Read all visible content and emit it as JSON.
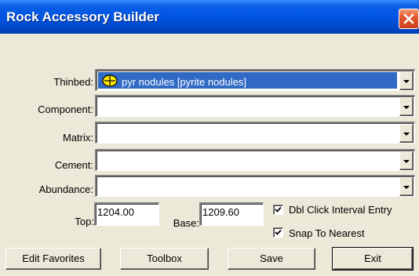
{
  "window": {
    "title": "Rock Accessory Builder"
  },
  "fields": {
    "thinbed": {
      "label": "Thinbed:",
      "value": "pyr nodules [pyrite nodules]",
      "icon": "pyrite-nodule-icon"
    },
    "component": {
      "label": "Component:",
      "value": ""
    },
    "matrix": {
      "label": "Matrix:",
      "value": ""
    },
    "cement": {
      "label": "Cement:",
      "value": ""
    },
    "abundance": {
      "label": "Abundance:",
      "value": ""
    }
  },
  "interval": {
    "top_label": "Top:",
    "top_value": "1204.00",
    "base_label": "Base:",
    "base_value": "1209.60"
  },
  "options": {
    "dbl_click_label": "Dbl Click Interval Entry",
    "dbl_click_checked": true,
    "snap_label": "Snap To Nearest",
    "snap_checked": true
  },
  "buttons": {
    "edit_favorites": "Edit Favorites",
    "toolbox": "Toolbox",
    "save": "Save",
    "exit": "Exit"
  },
  "colors": {
    "title_bar": "#0054E3",
    "selection": "#316AC5",
    "dialog_bg": "#ECE9D8",
    "close_button": "#E45A2E"
  }
}
